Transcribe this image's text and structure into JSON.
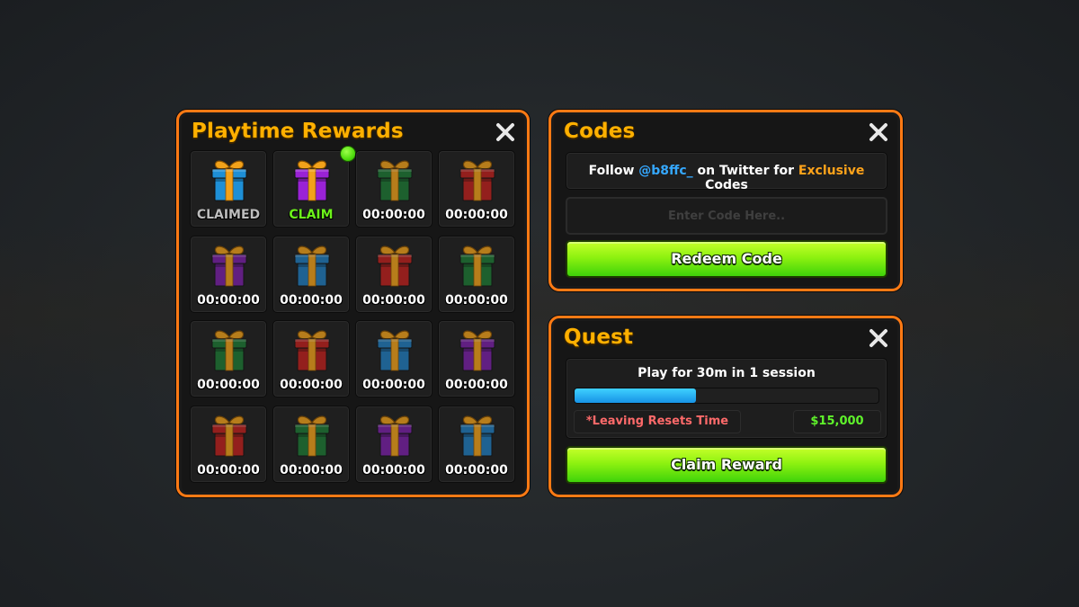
{
  "playtime": {
    "title": "Playtime Rewards",
    "close_icon": "close-x-icon",
    "slots": [
      {
        "label": "CLAIMED",
        "status": "claimed",
        "gift_color": "#1e8fd6",
        "gift_icon": "gift-box-icon"
      },
      {
        "label": "CLAIM",
        "status": "claimable",
        "gift_color": "#9a22d6",
        "gift_icon": "gift-box-icon"
      },
      {
        "label": "00:00:00",
        "status": "locked",
        "gift_color": "#1d7a35",
        "gift_icon": "gift-box-icon"
      },
      {
        "label": "00:00:00",
        "status": "locked",
        "gift_color": "#c0201d",
        "gift_icon": "gift-box-icon"
      },
      {
        "label": "00:00:00",
        "status": "locked",
        "gift_color": "#7b1fa8",
        "gift_icon": "gift-box-icon"
      },
      {
        "label": "00:00:00",
        "status": "locked",
        "gift_color": "#1f7dbf",
        "gift_icon": "gift-box-icon"
      },
      {
        "label": "00:00:00",
        "status": "locked",
        "gift_color": "#c0201d",
        "gift_icon": "gift-box-icon"
      },
      {
        "label": "00:00:00",
        "status": "locked",
        "gift_color": "#1d7a35",
        "gift_icon": "gift-box-icon"
      },
      {
        "label": "00:00:00",
        "status": "locked",
        "gift_color": "#1d7a35",
        "gift_icon": "gift-box-icon"
      },
      {
        "label": "00:00:00",
        "status": "locked",
        "gift_color": "#c0201d",
        "gift_icon": "gift-box-icon"
      },
      {
        "label": "00:00:00",
        "status": "locked",
        "gift_color": "#1f7dbf",
        "gift_icon": "gift-box-icon"
      },
      {
        "label": "00:00:00",
        "status": "locked",
        "gift_color": "#7b1fa8",
        "gift_icon": "gift-box-icon"
      },
      {
        "label": "00:00:00",
        "status": "locked",
        "gift_color": "#c0201d",
        "gift_icon": "gift-box-icon"
      },
      {
        "label": "00:00:00",
        "status": "locked",
        "gift_color": "#1d7a35",
        "gift_icon": "gift-box-icon"
      },
      {
        "label": "00:00:00",
        "status": "locked",
        "gift_color": "#7b1fa8",
        "gift_icon": "gift-box-icon"
      },
      {
        "label": "00:00:00",
        "status": "locked",
        "gift_color": "#1f7dbf",
        "gift_icon": "gift-box-icon"
      }
    ]
  },
  "codes": {
    "title": "Codes",
    "close_icon": "close-x-icon",
    "follow_prefix": "Follow ",
    "follow_handle": "@b8ffc_",
    "follow_middle": " on Twitter for ",
    "follow_highlight": "Exclusive",
    "follow_suffix": " Codes",
    "input_placeholder": "Enter Code Here..",
    "input_value": "",
    "redeem_label": "Redeem Code"
  },
  "quest": {
    "title": "Quest",
    "close_icon": "close-x-icon",
    "description": "Play for 30m in 1 session",
    "progress_fraction": 0.4,
    "warning": "*Leaving Resets Time",
    "reward": "$15,000",
    "claim_label": "Claim Reward"
  },
  "colors": {
    "panel_border": "#ff7a14",
    "title": "#ffb000",
    "button_green": "#8ef210",
    "progress_blue": "#1793e6",
    "handle_blue": "#35a8ff",
    "exclusive_orange": "#ffa31a",
    "warning_red": "#ff6a6a",
    "money_green": "#5ff22b"
  }
}
